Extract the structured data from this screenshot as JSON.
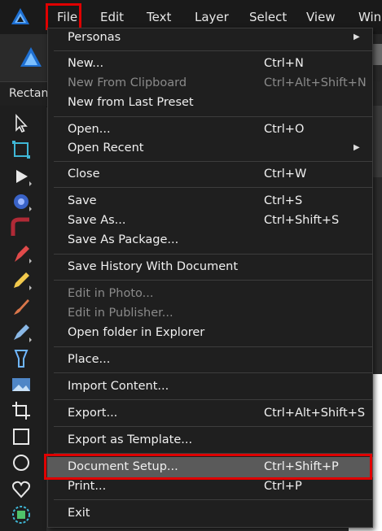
{
  "menubar": {
    "items": [
      "File",
      "Edit",
      "Text",
      "Layer",
      "Select",
      "View",
      "Win"
    ]
  },
  "context": {
    "tool_label": "Rectang"
  },
  "file_menu": {
    "items": [
      {
        "label": "Personas",
        "shortcut": "",
        "submenu": true,
        "disabled": false
      },
      {
        "label": "New...",
        "shortcut": "Ctrl+N",
        "submenu": false,
        "disabled": false
      },
      {
        "label": "New From Clipboard",
        "shortcut": "Ctrl+Alt+Shift+N",
        "submenu": false,
        "disabled": true
      },
      {
        "label": "New from Last Preset",
        "shortcut": "",
        "submenu": false,
        "disabled": false
      },
      {
        "label": "Open...",
        "shortcut": "Ctrl+O",
        "submenu": false,
        "disabled": false
      },
      {
        "label": "Open Recent",
        "shortcut": "",
        "submenu": true,
        "disabled": false
      },
      {
        "label": "Close",
        "shortcut": "Ctrl+W",
        "submenu": false,
        "disabled": false
      },
      {
        "label": "Save",
        "shortcut": "Ctrl+S",
        "submenu": false,
        "disabled": false
      },
      {
        "label": "Save As...",
        "shortcut": "Ctrl+Shift+S",
        "submenu": false,
        "disabled": false
      },
      {
        "label": "Save As Package...",
        "shortcut": "",
        "submenu": false,
        "disabled": false
      },
      {
        "label": "Save History With Document",
        "shortcut": "",
        "submenu": false,
        "disabled": false
      },
      {
        "label": "Edit in Photo...",
        "shortcut": "",
        "submenu": false,
        "disabled": true
      },
      {
        "label": "Edit in Publisher...",
        "shortcut": "",
        "submenu": false,
        "disabled": true
      },
      {
        "label": "Open folder in Explorer",
        "shortcut": "",
        "submenu": false,
        "disabled": false
      },
      {
        "label": "Place...",
        "shortcut": "",
        "submenu": false,
        "disabled": false
      },
      {
        "label": "Import Content...",
        "shortcut": "",
        "submenu": false,
        "disabled": false
      },
      {
        "label": "Export...",
        "shortcut": "Ctrl+Alt+Shift+S",
        "submenu": false,
        "disabled": false
      },
      {
        "label": "Export as Template...",
        "shortcut": "",
        "submenu": false,
        "disabled": false
      },
      {
        "label": "Document Setup...",
        "shortcut": "Ctrl+Shift+P",
        "submenu": false,
        "disabled": false,
        "highlighted": true
      },
      {
        "label": "Print...",
        "shortcut": "Ctrl+P",
        "submenu": false,
        "disabled": false
      },
      {
        "label": "Exit",
        "shortcut": "",
        "submenu": false,
        "disabled": false
      }
    ]
  },
  "tools": [
    "move-tool-icon",
    "artboard-tool-icon",
    "node-tool-icon",
    "point-transform-tool-icon",
    "corner-tool-icon",
    "pen-tool-icon",
    "pencil-tool-icon",
    "vector-brush-tool-icon",
    "paint-brush-tool-icon",
    "fill-tool-icon",
    "place-image-tool-icon",
    "crop-tool-icon",
    "rectangle-tool-icon",
    "ellipse-tool-icon",
    "heart-shape-tool-icon",
    "shape-builder-tool-icon"
  ],
  "colors": {
    "accent_highlight": "#e00000",
    "brand": "#1f6fd1"
  }
}
